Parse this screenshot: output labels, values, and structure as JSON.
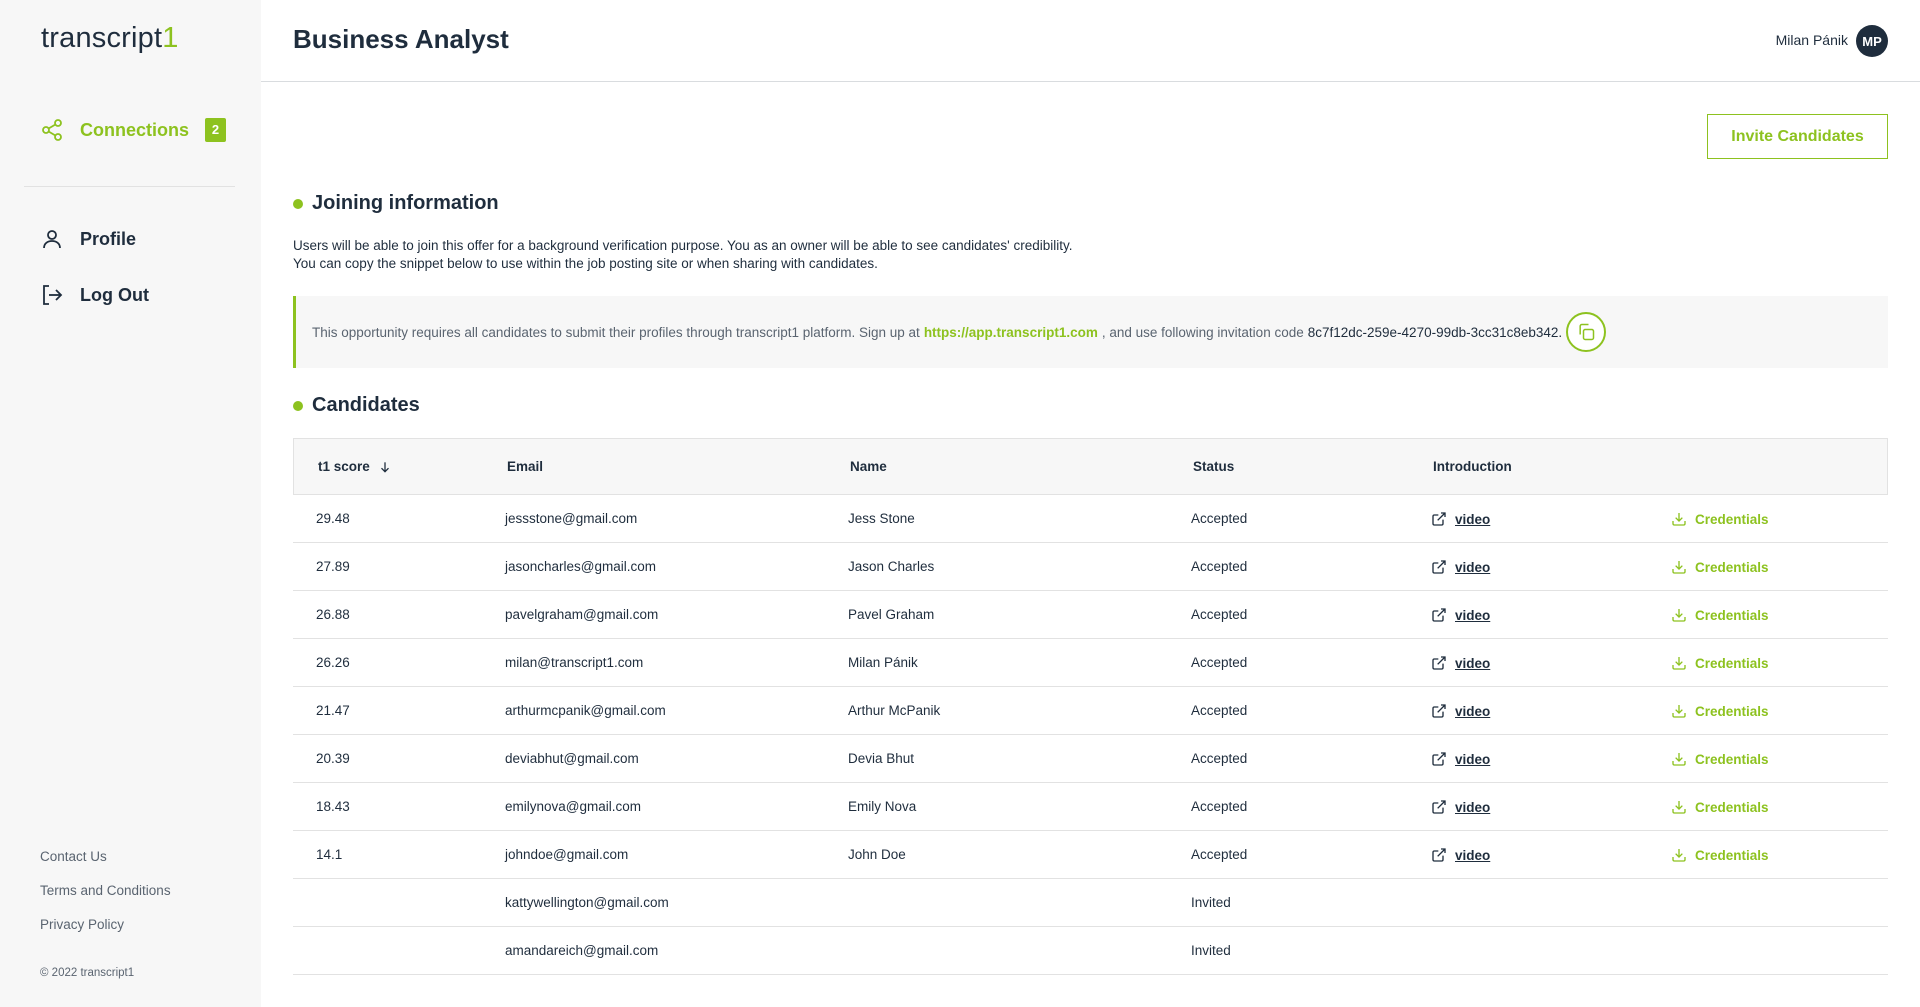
{
  "sidebar": {
    "logo_text": "transcript",
    "logo_accent": "1",
    "nav": {
      "connections": {
        "label": "Connections",
        "badge": "2",
        "icon": "share-icon"
      },
      "profile": {
        "label": "Profile",
        "icon": "user-icon"
      },
      "logout": {
        "label": "Log Out",
        "icon": "logout-icon"
      }
    },
    "footer": {
      "contact": "Contact Us",
      "terms": "Terms and Conditions",
      "privacy": "Privacy Policy",
      "copyright": "© 2022 transcript1"
    }
  },
  "header": {
    "title": "Business Analyst",
    "user_name": "Milan Pánik",
    "avatar_initials": "MP"
  },
  "main": {
    "invite_button": "Invite Candidates",
    "joining": {
      "title": "Joining information",
      "desc_line1": "Users will be able to join this offer for a background verification purpose. You as an owner will be able to see candidates' credibility.",
      "desc_line2": "You can copy the snippet below to use within the job posting site or when sharing with candidates.",
      "snippet_prefix": "This opportunity requires all candidates to submit their profiles through transcript1 platform. Sign up at",
      "snippet_link": "https://app.transcript1.com",
      "snippet_middle": ", and use following invitation code",
      "snippet_code": "8c7f12dc-259e-4270-99db-3cc31c8eb342."
    },
    "candidates": {
      "title": "Candidates",
      "columns": {
        "score": "t1 score",
        "email": "Email",
        "name": "Name",
        "status": "Status",
        "intro": "Introduction"
      },
      "video_label": "video",
      "credentials_label": "Credentials",
      "rows": [
        {
          "score": "29.48",
          "email": "jessstone@gmail.com",
          "name": "Jess Stone",
          "status": "Accepted"
        },
        {
          "score": "27.89",
          "email": "jasoncharles@gmail.com",
          "name": "Jason Charles",
          "status": "Accepted"
        },
        {
          "score": "26.88",
          "email": "pavelgraham@gmail.com",
          "name": "Pavel Graham",
          "status": "Accepted"
        },
        {
          "score": "26.26",
          "email": "milan@transcript1.com",
          "name": "Milan Pánik",
          "status": "Accepted"
        },
        {
          "score": "21.47",
          "email": "arthurmcpanik@gmail.com",
          "name": "Arthur McPanik",
          "status": "Accepted"
        },
        {
          "score": "20.39",
          "email": "deviabhut@gmail.com",
          "name": "Devia Bhut",
          "status": "Accepted"
        },
        {
          "score": "18.43",
          "email": "emilynova@gmail.com",
          "name": "Emily Nova",
          "status": "Accepted"
        },
        {
          "score": "14.1",
          "email": "johndoe@gmail.com",
          "name": "John Doe",
          "status": "Accepted"
        },
        {
          "score": "",
          "email": "kattywellington@gmail.com",
          "name": "",
          "status": "Invited"
        },
        {
          "score": "",
          "email": "amandareich@gmail.com",
          "name": "",
          "status": "Invited"
        }
      ]
    }
  },
  "colors": {
    "accent": "#8dc21f",
    "text": "#1f2d3d",
    "sidebar_bg": "#f7f7f7"
  }
}
